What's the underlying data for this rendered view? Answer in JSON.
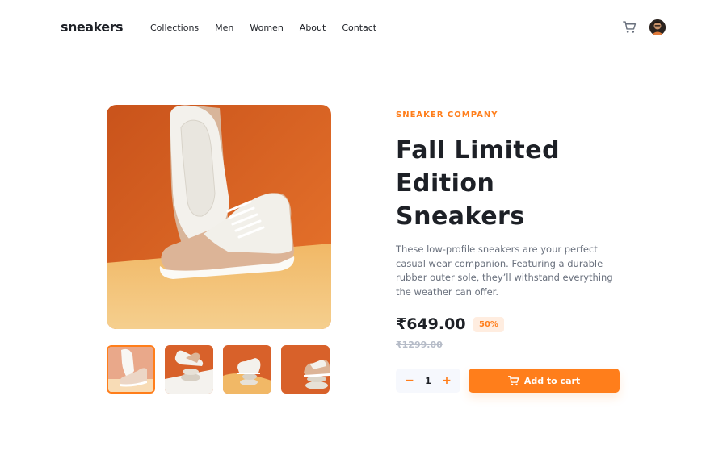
{
  "header": {
    "logo": "sneakers",
    "nav": [
      "Collections",
      "Men",
      "Women",
      "About",
      "Contact"
    ],
    "cart_icon": "cart-icon",
    "avatar_icon": "user-avatar"
  },
  "product": {
    "company": "SNEAKER COMPANY",
    "title": "Fall Limited Edition Sneakers",
    "description": "These low-profile sneakers are your perfect casual wear companion. Featuring a durable rubber outer sole, they’ll withstand everything the weather can offer.",
    "price": "₹649.00",
    "discount": "50%",
    "original_price": "₹1299.00",
    "quantity": "1",
    "minus_label": "−",
    "plus_label": "+",
    "add_to_cart_label": "Add to cart"
  },
  "gallery": {
    "selected_thumbnail": 1,
    "thumbnails": [
      "thumbnail-1",
      "thumbnail-2",
      "thumbnail-3",
      "thumbnail-4"
    ]
  },
  "colors": {
    "accent": "#ff7e1b",
    "accent_light": "#ffede0",
    "dark": "#1d2026",
    "text_gray": "#69707d"
  }
}
